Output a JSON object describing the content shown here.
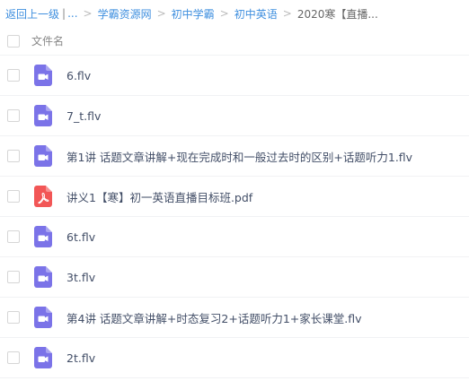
{
  "breadcrumb": {
    "back_label": "返回上一级",
    "pipe": "|",
    "ellipsis": "...",
    "sep": ">",
    "items": [
      "学霸资源网",
      "初中学霸",
      "初中英语"
    ],
    "current": "2020寒【直播..."
  },
  "list_header": {
    "name_label": "文件名"
  },
  "files": [
    {
      "name": "6.flv",
      "icon": "video-icon",
      "checked": false
    },
    {
      "name": "7_t.flv",
      "icon": "video-icon",
      "checked": false
    },
    {
      "name": "第1讲 话题文章讲解+现在完成时和一般过去时的区别+话题听力1.flv",
      "icon": "video-icon",
      "checked": false
    },
    {
      "name": "讲义1【寒】初一英语直播目标班.pdf",
      "icon": "pdf-icon",
      "checked": false
    },
    {
      "name": "6t.flv",
      "icon": "video-icon",
      "checked": false
    },
    {
      "name": "3t.flv",
      "icon": "video-icon",
      "checked": false
    },
    {
      "name": "第4讲 话题文章讲解+时态复习2+话题听力1+家长课堂.flv",
      "icon": "video-icon",
      "checked": false
    },
    {
      "name": "2t.flv",
      "icon": "video-icon",
      "checked": false
    }
  ],
  "colors": {
    "link": "#3f8fdf",
    "video_icon": "#7b73e8",
    "pdf_icon": "#f25656",
    "text": "#424e67"
  }
}
